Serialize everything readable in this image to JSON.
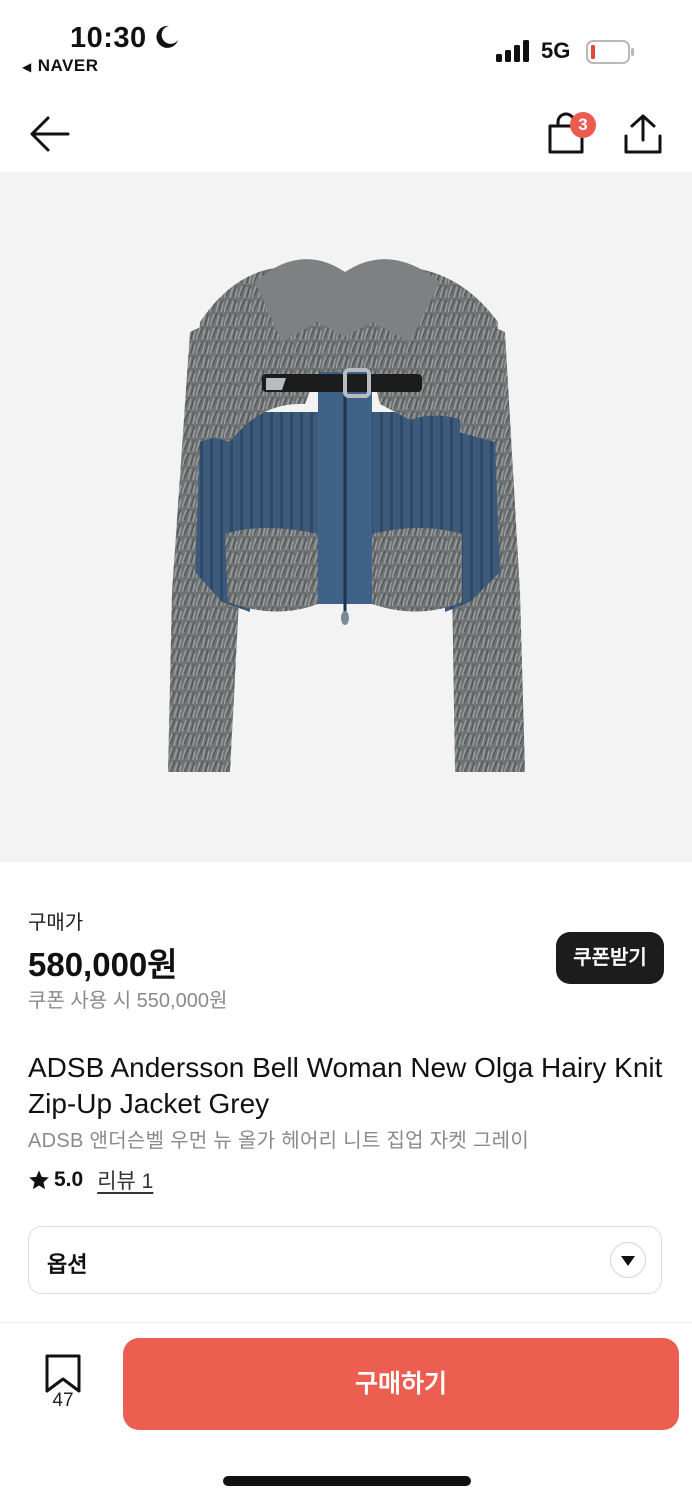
{
  "status_bar": {
    "time": "10:30",
    "back_app": "NAVER",
    "network": "5G",
    "icons": [
      "moon-icon",
      "signal-icon",
      "battery-icon"
    ]
  },
  "nav": {
    "icons": [
      "back-arrow-icon",
      "shopping-bag-icon",
      "share-icon"
    ],
    "cart_count": "3"
  },
  "product": {
    "price_label": "구매가",
    "price": "580,000원",
    "coupon_price": "쿠폰 사용 시 550,000원",
    "coupon_button": "쿠폰받기",
    "title_en": "ADSB Andersson Bell Woman New Olga Hairy Knit Zip-Up Jacket Grey",
    "title_ko": "ADSB 앤더슨벨 우먼 뉴 올가 헤어리 니트 집업 자켓 그레이",
    "rating": "5.0",
    "review_link": "리뷰 1"
  },
  "options": {
    "label": "옵션"
  },
  "bottom": {
    "bookmark_count": "47",
    "buy_button": "구매하기"
  },
  "colors": {
    "accent": "#ec5f50",
    "badge": "#ec5b4f",
    "dark_button": "#1c1c1c",
    "image_bg": "#f3f3f3"
  }
}
